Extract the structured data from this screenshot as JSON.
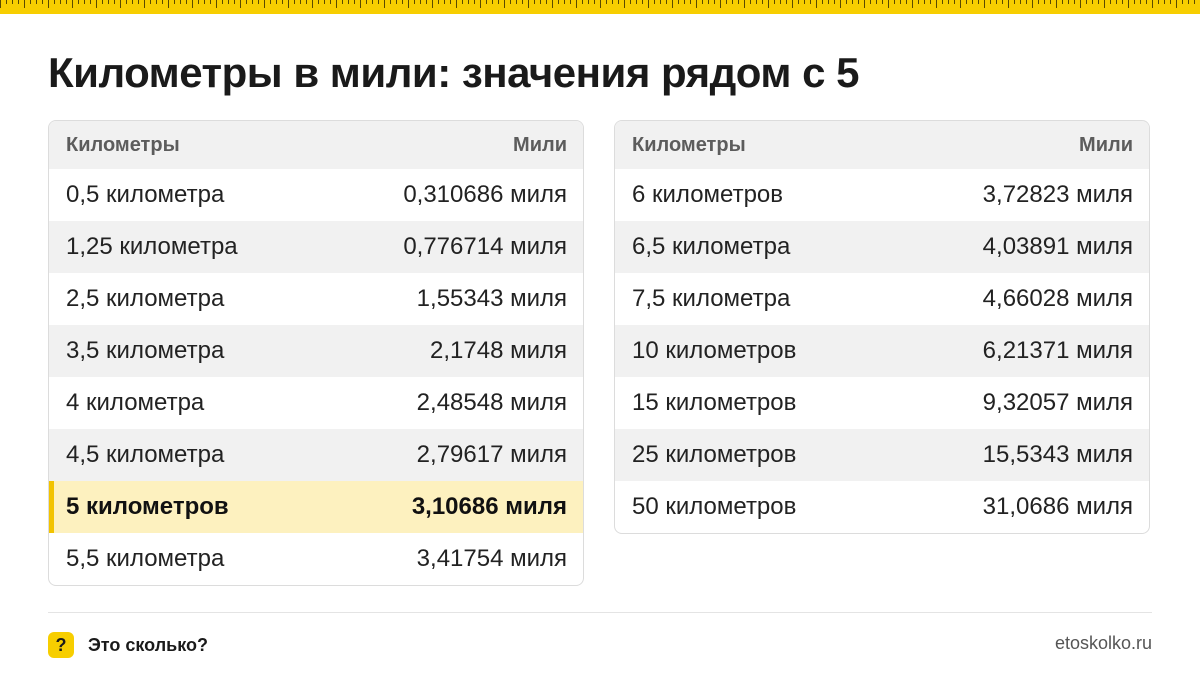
{
  "title": "Километры в мили: значения рядом с 5",
  "accent_color": "#f7ce00",
  "highlight_color": "#fdf1bf",
  "left_table": {
    "header": {
      "col1": "Километры",
      "col2": "Мили"
    },
    "rows": [
      {
        "km": "0,5 километра",
        "mi": "0,310686 миля"
      },
      {
        "km": "1,25 километра",
        "mi": "0,776714 миля"
      },
      {
        "km": "2,5 километра",
        "mi": "1,55343 миля"
      },
      {
        "km": "3,5 километра",
        "mi": "2,1748 миля"
      },
      {
        "km": "4 километра",
        "mi": "2,48548 миля"
      },
      {
        "km": "4,5 километра",
        "mi": "2,79617 миля"
      },
      {
        "km": "5 километров",
        "mi": "3,10686 миля"
      },
      {
        "km": "5,5 километра",
        "mi": "3,41754 миля"
      }
    ]
  },
  "right_table": {
    "header": {
      "col1": "Километры",
      "col2": "Мили"
    },
    "rows": [
      {
        "km": "6 километров",
        "mi": "3,72823 миля"
      },
      {
        "km": "6,5 километра",
        "mi": "4,03891 миля"
      },
      {
        "km": "7,5 километра",
        "mi": "4,66028 миля"
      },
      {
        "km": "10 километров",
        "mi": "6,21371 миля"
      },
      {
        "km": "15 километров",
        "mi": "9,32057 миля"
      },
      {
        "km": "25 километров",
        "mi": "15,5343 миля"
      },
      {
        "km": "50 километров",
        "mi": "31,0686 миля"
      }
    ]
  },
  "footer": {
    "badge_icon": "?",
    "brand_name": "Это сколько?",
    "site": "etoskolko.ru"
  }
}
